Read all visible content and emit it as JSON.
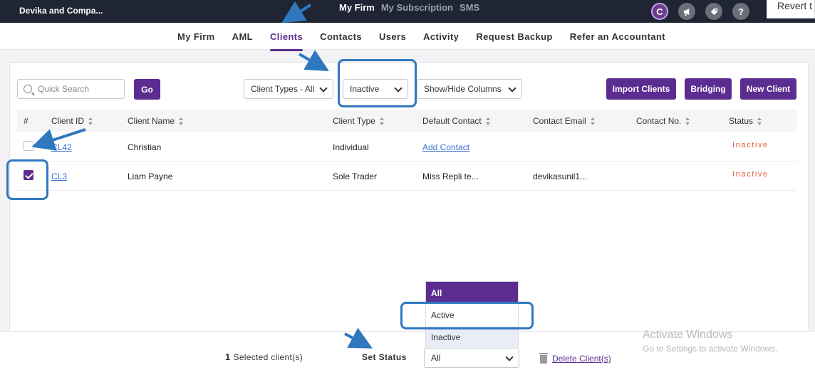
{
  "app": {
    "firm_name": "Devika and Compa...",
    "top_nav": [
      "My Firm",
      "My Subscription",
      "SMS"
    ],
    "revert_label": "Revert t"
  },
  "top_icons": [
    "brand-icon",
    "megaphone-icon",
    "tag-icon",
    "help-icon"
  ],
  "subnav": [
    "My Firm",
    "AML",
    "Clients",
    "Contacts",
    "Users",
    "Activity",
    "Request Backup",
    "Refer an Accountant"
  ],
  "toolbar": {
    "search_placeholder": "Quick Search",
    "go_label": "Go",
    "client_types": "Client Types - All",
    "status_filter": "Inactive",
    "show_hide": "Show/Hide Columns",
    "import_label": "Import Clients",
    "bridging_label": "Bridging",
    "new_client_label": "New Client"
  },
  "table": {
    "headers": [
      "#",
      "Client ID",
      "Client Name",
      "Client Type",
      "Default Contact",
      "Contact Email",
      "Contact No.",
      "Status"
    ],
    "rows": [
      {
        "checked": false,
        "id": "CL42",
        "name": "Christian",
        "type": "Individual",
        "contact": "Add Contact",
        "email": "",
        "phone": "",
        "status": "Inactive"
      },
      {
        "checked": true,
        "id": "CL3",
        "name": "Liam Payne",
        "type": "Sole Trader",
        "contact": "Miss Repli te...",
        "email": "devikasunil1...",
        "phone": "",
        "status": "Inactive"
      }
    ]
  },
  "status_dropdown": {
    "options": [
      "All",
      "Active",
      "Inactive"
    ],
    "selected": "All"
  },
  "bottom": {
    "selected_count": "1",
    "selected_text": "Selected client(s)",
    "set_status_label": "Set Status",
    "set_status_value": "All",
    "delete_label": "Delete Client(s)"
  },
  "watermark": {
    "line1": "Activate Windows",
    "line2": "Go to Settings to activate Windows."
  },
  "colors": {
    "primary": "#5c2d91",
    "topbar": "#1f2533",
    "inactive_status": "#e85c3a",
    "annotation": "#2f78bf"
  }
}
